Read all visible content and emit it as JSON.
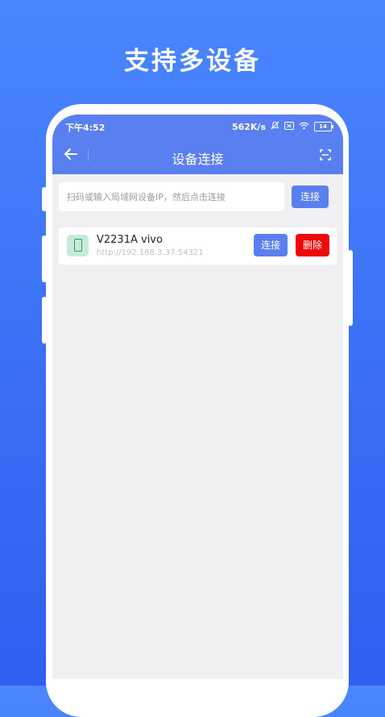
{
  "headline": "支持多设备",
  "status_bar": {
    "time": "下午4:52",
    "speed": "562K/s",
    "battery": "14"
  },
  "nav": {
    "title": "设备连接",
    "back_icon": "arrow-left-icon",
    "scan_icon": "scan-icon"
  },
  "ip_input": {
    "placeholder": "扫码或输入局域网设备IP，然后点击连接",
    "value": ""
  },
  "connect_button_label": "连接",
  "devices": [
    {
      "name": "V2231A vivo",
      "address": "http://192.168.3.37:54321",
      "connect_label": "连接",
      "delete_label": "删除"
    }
  ],
  "colors": {
    "accent": "#5a7ff0",
    "delete": "#ee0a0a",
    "background_top": "#4a86ff"
  }
}
